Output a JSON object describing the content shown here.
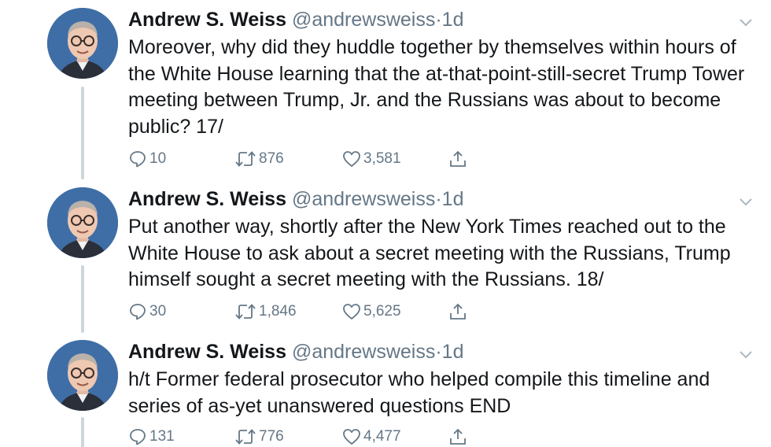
{
  "tweets": [
    {
      "display_name": "Andrew S. Weiss",
      "handle": "@andrewsweiss",
      "dot": "·",
      "time": "1d",
      "text": "Moreover, why did they huddle together by themselves within hours of the White House learning that the at-that-point-still-secret Trump Tower meeting between Trump, Jr. and the Russians was about to become public? 17/",
      "replies": "10",
      "retweets": "876",
      "likes": "3,581"
    },
    {
      "display_name": "Andrew S. Weiss",
      "handle": "@andrewsweiss",
      "dot": "·",
      "time": "1d",
      "text": "Put another way, shortly after the New York Times reached out to the White House to ask about a secret meeting with the Russians, Trump himself sought a secret meeting with the Russians. 18/",
      "replies": "30",
      "retweets": "1,846",
      "likes": "5,625"
    },
    {
      "display_name": "Andrew S. Weiss",
      "handle": "@andrewsweiss",
      "dot": "·",
      "time": "1d",
      "text": "h/t Former federal prosecutor who helped compile this timeline and series of as-yet unanswered questions END",
      "replies": "131",
      "retweets": "776",
      "likes": "4,477"
    }
  ],
  "icons": {
    "reply": "reply-icon",
    "retweet": "retweet-icon",
    "like": "heart-icon",
    "share": "share-icon",
    "menu": "chevron-down-icon"
  },
  "colors": {
    "text": "#14171a",
    "secondary": "#657786",
    "thread_line": "#cdd6dd",
    "avatar_bg": "#3f6ea7"
  }
}
